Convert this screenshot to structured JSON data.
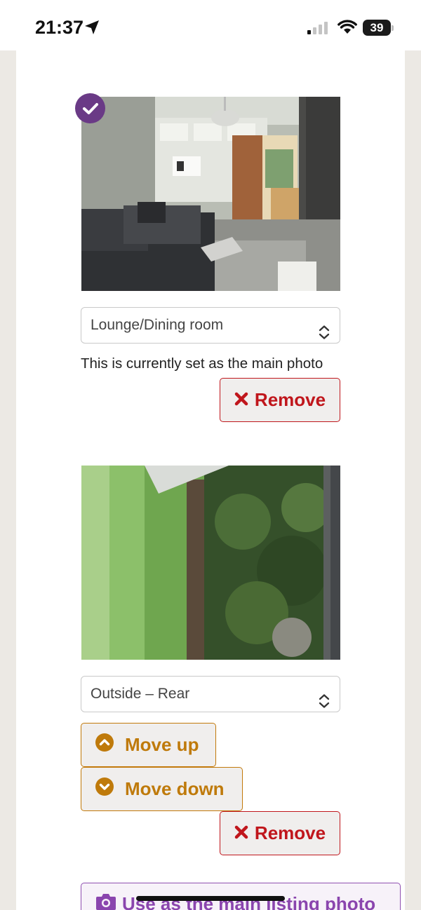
{
  "status_bar": {
    "time": "21:37",
    "battery": "39",
    "icons": [
      "location-arrow-icon",
      "signal-icon",
      "wifi-icon",
      "battery-icon"
    ]
  },
  "photos": [
    {
      "room": "Lounge/Dining room",
      "is_main": true,
      "main_note": "This is currently set as the main photo",
      "remove_label": "Remove"
    },
    {
      "room": "Outside – Rear",
      "is_main": false,
      "move_up_label": "Move up",
      "move_down_label": "Move down",
      "remove_label": "Remove",
      "main_button_label": "Use as the main listing photo"
    }
  ],
  "colors": {
    "brand_purple": "#6a3a86",
    "remove_red": "#c0161c",
    "move_amber": "#bf7a0b",
    "main_purple": "#8a45ae"
  }
}
